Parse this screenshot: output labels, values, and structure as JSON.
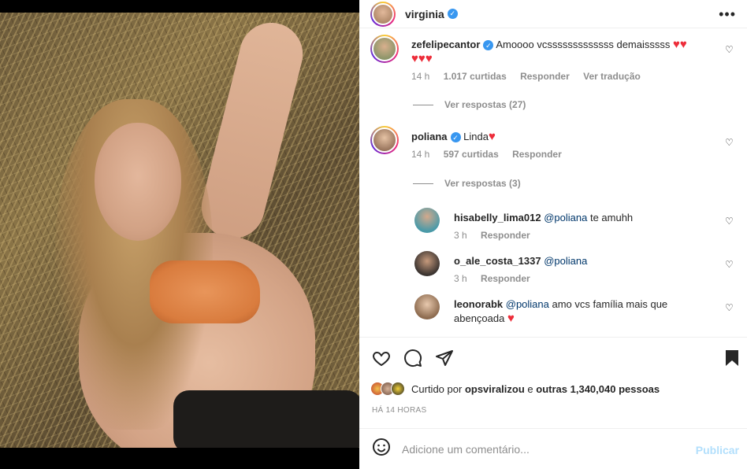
{
  "post": {
    "author": "virginia",
    "more_label": "•••"
  },
  "comments": [
    {
      "user": "zefelipecantor",
      "verified": true,
      "text": "Amoooo vcsssssssssssss demaisssss",
      "hearts_line1": "♥♥",
      "hearts_line2": "♥♥♥",
      "time": "14 h",
      "likes": "1.017 curtidas",
      "reply": "Responder",
      "translate": "Ver tradução",
      "view_replies": "Ver respostas (27)"
    },
    {
      "user": "poliana",
      "verified": true,
      "text": "Linda",
      "hearts": "♥",
      "time": "14 h",
      "likes": "597 curtidas",
      "reply": "Responder",
      "view_replies": "Ver respostas (3)"
    }
  ],
  "replies": [
    {
      "user": "hisabelly_lima012",
      "mention": "@poliana",
      "text": "te amuhh",
      "time": "3 h",
      "reply": "Responder"
    },
    {
      "user": "o_ale_costa_1337",
      "mention": "@poliana",
      "text": "",
      "time": "3 h",
      "reply": "Responder"
    },
    {
      "user": "leonorabk",
      "mention": "@poliana",
      "text": "amo vcs família mais que",
      "text2": "abençoada",
      "heart": "♥"
    }
  ],
  "actions": {
    "liked_by_prefix": "Curtido por",
    "liked_by_user": "opsviralizou",
    "liked_by_middle": "e",
    "liked_by_others": "outras 1,340,040 pessoas",
    "time_ago": "HÁ 14 HORAS"
  },
  "comment_box": {
    "placeholder": "Adicione um comentário...",
    "publish": "Publicar"
  },
  "colors": {
    "verified": "#3897f0",
    "heart_red": "#ed2d3a",
    "publish_disabled": "#b2dffc"
  }
}
